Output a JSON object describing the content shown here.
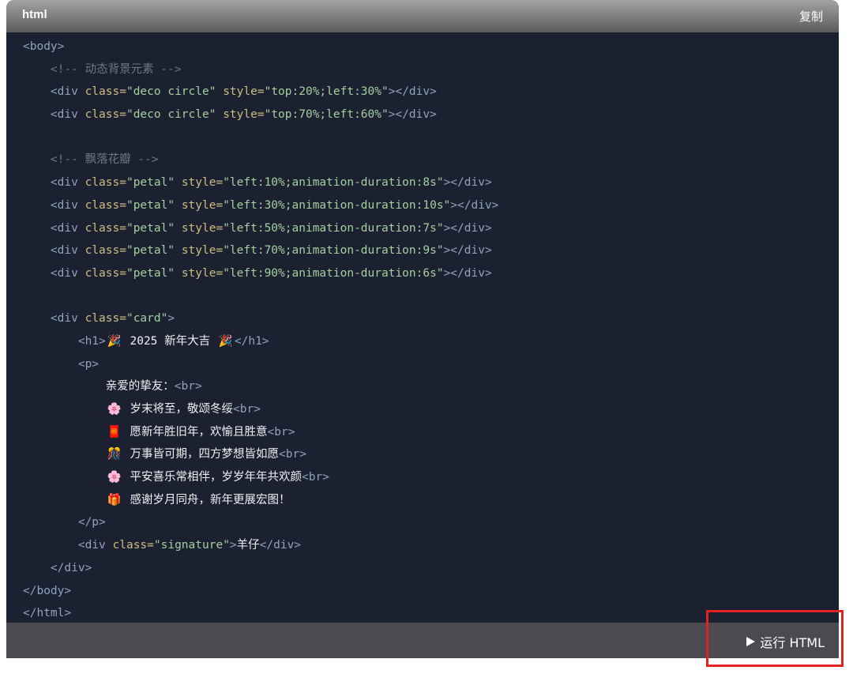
{
  "header": {
    "language": "html",
    "copy_label": "复制"
  },
  "footer": {
    "run_label": "运行 HTML"
  },
  "colors": {
    "tag": "#8ea3bd",
    "attr": "#d0bd80",
    "string": "#a6cfa0",
    "comment": "#6e7686",
    "text": "#f0f1f3",
    "highlight": "#e02222"
  },
  "code_lines": [
    [
      {
        "t": "tag",
        "v": "<body>"
      }
    ],
    [
      {
        "t": "text",
        "v": "    "
      },
      {
        "t": "cmt",
        "v": "<!-- 动态背景元素 -->"
      }
    ],
    [
      {
        "t": "text",
        "v": "    "
      },
      {
        "t": "tag",
        "v": "<div "
      },
      {
        "t": "attr",
        "v": "class="
      },
      {
        "t": "str",
        "v": "\"deco circle\""
      },
      {
        "t": "text",
        "v": " "
      },
      {
        "t": "attr",
        "v": "style="
      },
      {
        "t": "str",
        "v": "\"top:20%;left:30%\""
      },
      {
        "t": "tag",
        "v": "></div>"
      }
    ],
    [
      {
        "t": "text",
        "v": "    "
      },
      {
        "t": "tag",
        "v": "<div "
      },
      {
        "t": "attr",
        "v": "class="
      },
      {
        "t": "str",
        "v": "\"deco circle\""
      },
      {
        "t": "text",
        "v": " "
      },
      {
        "t": "attr",
        "v": "style="
      },
      {
        "t": "str",
        "v": "\"top:70%;left:60%\""
      },
      {
        "t": "tag",
        "v": "></div>"
      }
    ],
    [],
    [
      {
        "t": "text",
        "v": "    "
      },
      {
        "t": "cmt",
        "v": "<!-- 飘落花瓣 -->"
      }
    ],
    [
      {
        "t": "text",
        "v": "    "
      },
      {
        "t": "tag",
        "v": "<div "
      },
      {
        "t": "attr",
        "v": "class="
      },
      {
        "t": "str",
        "v": "\"petal\""
      },
      {
        "t": "text",
        "v": " "
      },
      {
        "t": "attr",
        "v": "style="
      },
      {
        "t": "str",
        "v": "\"left:10%;animation-duration:8s\""
      },
      {
        "t": "tag",
        "v": "></div>"
      }
    ],
    [
      {
        "t": "text",
        "v": "    "
      },
      {
        "t": "tag",
        "v": "<div "
      },
      {
        "t": "attr",
        "v": "class="
      },
      {
        "t": "str",
        "v": "\"petal\""
      },
      {
        "t": "text",
        "v": " "
      },
      {
        "t": "attr",
        "v": "style="
      },
      {
        "t": "str",
        "v": "\"left:30%;animation-duration:10s\""
      },
      {
        "t": "tag",
        "v": "></div>"
      }
    ],
    [
      {
        "t": "text",
        "v": "    "
      },
      {
        "t": "tag",
        "v": "<div "
      },
      {
        "t": "attr",
        "v": "class="
      },
      {
        "t": "str",
        "v": "\"petal\""
      },
      {
        "t": "text",
        "v": " "
      },
      {
        "t": "attr",
        "v": "style="
      },
      {
        "t": "str",
        "v": "\"left:50%;animation-duration:7s\""
      },
      {
        "t": "tag",
        "v": "></div>"
      }
    ],
    [
      {
        "t": "text",
        "v": "    "
      },
      {
        "t": "tag",
        "v": "<div "
      },
      {
        "t": "attr",
        "v": "class="
      },
      {
        "t": "str",
        "v": "\"petal\""
      },
      {
        "t": "text",
        "v": " "
      },
      {
        "t": "attr",
        "v": "style="
      },
      {
        "t": "str",
        "v": "\"left:70%;animation-duration:9s\""
      },
      {
        "t": "tag",
        "v": "></div>"
      }
    ],
    [
      {
        "t": "text",
        "v": "    "
      },
      {
        "t": "tag",
        "v": "<div "
      },
      {
        "t": "attr",
        "v": "class="
      },
      {
        "t": "str",
        "v": "\"petal\""
      },
      {
        "t": "text",
        "v": " "
      },
      {
        "t": "attr",
        "v": "style="
      },
      {
        "t": "str",
        "v": "\"left:90%;animation-duration:6s\""
      },
      {
        "t": "tag",
        "v": "></div>"
      }
    ],
    [],
    [
      {
        "t": "text",
        "v": "    "
      },
      {
        "t": "tag",
        "v": "<div "
      },
      {
        "t": "attr",
        "v": "class="
      },
      {
        "t": "str",
        "v": "\"card\""
      },
      {
        "t": "tag",
        "v": ">"
      }
    ],
    [
      {
        "t": "text",
        "v": "        "
      },
      {
        "t": "tag",
        "v": "<h1>"
      },
      {
        "t": "emoji",
        "v": "🎉"
      },
      {
        "t": "text",
        "v": " 2025 新年大吉 "
      },
      {
        "t": "emoji",
        "v": "🎉"
      },
      {
        "t": "tag",
        "v": "</h1>"
      }
    ],
    [
      {
        "t": "text",
        "v": "        "
      },
      {
        "t": "tag",
        "v": "<p>"
      }
    ],
    [
      {
        "t": "text",
        "v": "            亲爱的挚友："
      },
      {
        "t": "tag",
        "v": "<br>"
      }
    ],
    [
      {
        "t": "text",
        "v": "            "
      },
      {
        "t": "emoji",
        "v": "🌸"
      },
      {
        "t": "text",
        "v": " 岁末将至，敬颂冬绥"
      },
      {
        "t": "tag",
        "v": "<br>"
      }
    ],
    [
      {
        "t": "text",
        "v": "            "
      },
      {
        "t": "emoji",
        "v": "🧧"
      },
      {
        "t": "text",
        "v": " 愿新年胜旧年，欢愉且胜意"
      },
      {
        "t": "tag",
        "v": "<br>"
      }
    ],
    [
      {
        "t": "text",
        "v": "            "
      },
      {
        "t": "emoji",
        "v": "🎊"
      },
      {
        "t": "text",
        "v": " 万事皆可期，四方梦想皆如愿"
      },
      {
        "t": "tag",
        "v": "<br>"
      }
    ],
    [
      {
        "t": "text",
        "v": "            "
      },
      {
        "t": "emoji",
        "v": "🌸"
      },
      {
        "t": "text",
        "v": " 平安喜乐常相伴，岁岁年年共欢颜"
      },
      {
        "t": "tag",
        "v": "<br>"
      }
    ],
    [
      {
        "t": "text",
        "v": "            "
      },
      {
        "t": "emoji",
        "v": "🎁"
      },
      {
        "t": "text",
        "v": " 感谢岁月同舟，新年更展宏图！"
      }
    ],
    [
      {
        "t": "text",
        "v": "        "
      },
      {
        "t": "tag",
        "v": "</p>"
      }
    ],
    [
      {
        "t": "text",
        "v": "        "
      },
      {
        "t": "tag",
        "v": "<div "
      },
      {
        "t": "attr",
        "v": "class="
      },
      {
        "t": "str",
        "v": "\"signature\""
      },
      {
        "t": "tag",
        "v": ">"
      },
      {
        "t": "text",
        "v": "羊仔"
      },
      {
        "t": "tag",
        "v": "</div>"
      }
    ],
    [
      {
        "t": "text",
        "v": "    "
      },
      {
        "t": "tag",
        "v": "</div>"
      }
    ],
    [
      {
        "t": "tag",
        "v": "</body>"
      }
    ],
    [
      {
        "t": "tag",
        "v": "</html>"
      }
    ]
  ]
}
